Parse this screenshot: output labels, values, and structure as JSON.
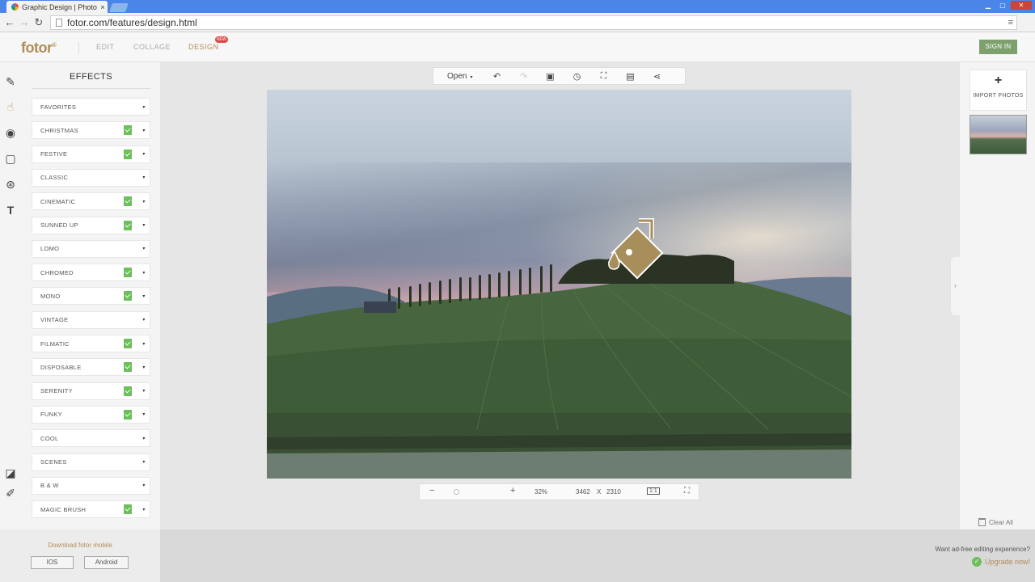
{
  "browser": {
    "tab_title": "Graphic Design | Photo",
    "tab_close": "×",
    "url": "fotor.com/features/design.html",
    "window_controls": [
      "▁",
      "▢",
      "✕"
    ]
  },
  "app": {
    "logo": "fotor",
    "logo_mark": "®",
    "nav": [
      {
        "label": "EDIT",
        "active": false
      },
      {
        "label": "COLLAGE",
        "active": false
      },
      {
        "label": "DESIGN",
        "active": true
      }
    ],
    "new_badge": "NEW",
    "sign_in": "SIGN IN"
  },
  "rail_icons": [
    "pencil-icon",
    "hand-touch-icon",
    "eye-icon",
    "frame-icon",
    "sticker-icon",
    "text-icon",
    "compare-icon",
    "edit-note-icon"
  ],
  "effects": {
    "title": "EFFECTS",
    "items": [
      {
        "label": "FAVORITES",
        "tagged": false
      },
      {
        "label": "CHRISTMAS",
        "tagged": true
      },
      {
        "label": "FESTIVE",
        "tagged": true
      },
      {
        "label": "CLASSIC",
        "tagged": false
      },
      {
        "label": "CINEMATIC",
        "tagged": true
      },
      {
        "label": "SUNNED UP",
        "tagged": true
      },
      {
        "label": "LOMO",
        "tagged": false
      },
      {
        "label": "CHROMED",
        "tagged": true
      },
      {
        "label": "MONO",
        "tagged": true
      },
      {
        "label": "VINTAGE",
        "tagged": false
      },
      {
        "label": "FILMATIC",
        "tagged": true
      },
      {
        "label": "DISPOSABLE",
        "tagged": true
      },
      {
        "label": "SERENITY",
        "tagged": true
      },
      {
        "label": "FUNKY",
        "tagged": true
      },
      {
        "label": "COOL",
        "tagged": false
      },
      {
        "label": "SCENES",
        "tagged": false
      },
      {
        "label": "B & W",
        "tagged": false
      },
      {
        "label": "MAGIC BRUSH",
        "tagged": true
      }
    ],
    "arrow": "▾"
  },
  "toolbar": {
    "open_label": "Open",
    "open_caret": "▾",
    "buttons": [
      {
        "name": "undo-icon",
        "glyph": "↶",
        "enabled": true
      },
      {
        "name": "redo-icon",
        "glyph": "↷",
        "enabled": false
      },
      {
        "name": "image-icon",
        "glyph": "▣",
        "enabled": true
      },
      {
        "name": "history-icon",
        "glyph": "◷",
        "enabled": true
      },
      {
        "name": "zoom-fit-icon",
        "glyph": "⛶",
        "enabled": true
      },
      {
        "name": "save-icon",
        "glyph": "▤",
        "enabled": true
      },
      {
        "name": "share-icon",
        "glyph": "⋖",
        "enabled": true
      }
    ]
  },
  "zoom": {
    "minus": "−",
    "plus": "+",
    "percent": "32%",
    "width": "3462",
    "x": "X",
    "height": "2310",
    "one_to_one": "1:1",
    "fullscreen": "⛶"
  },
  "right": {
    "import_plus": "+",
    "import_label": "IMPORT PHOTOS",
    "collapse": "›",
    "clear_all": "Clear All"
  },
  "footer": {
    "download_text": "Download fotor mobile",
    "ios": "IOS",
    "android": "Android",
    "promo_question": "Want ad-free editing experience?",
    "upgrade": "Upgrade now!"
  },
  "colors": {
    "brand": "#b08d57",
    "tag_green": "#6cbf5a",
    "signin_green": "#7ea06f"
  }
}
